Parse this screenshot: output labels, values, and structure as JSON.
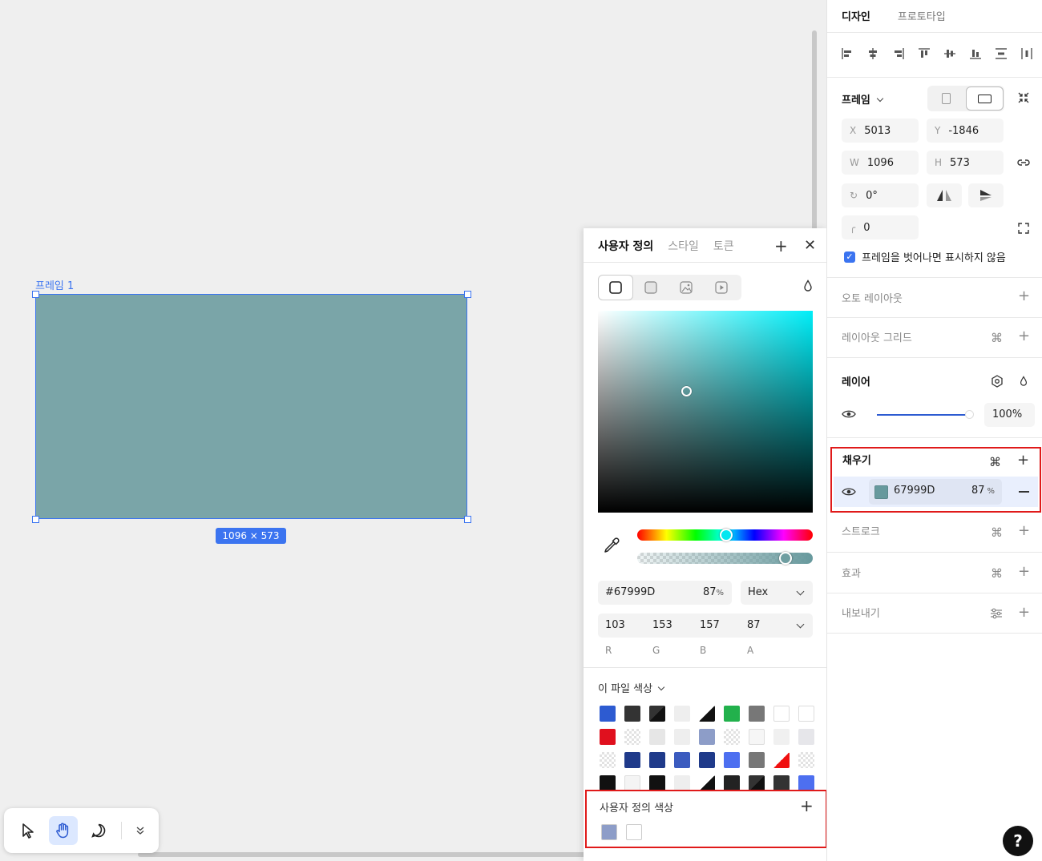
{
  "canvas": {
    "frame_label": "프레임 1",
    "frame_color": "#7aa5a8",
    "size_badge": "1096 × 573"
  },
  "toolbar": {
    "tools": [
      "pointer-icon",
      "hand-icon",
      "comment-icon",
      "chevron-double-down-icon"
    ],
    "active_tool": "hand-icon"
  },
  "color_picker": {
    "tabs": [
      "사용자 정의",
      "스타일",
      "토큰"
    ],
    "active_tab": "사용자 정의",
    "hex_value": "#67999D",
    "opacity": "87",
    "opacity_unit": "%",
    "format": "Hex",
    "rgba_values": [
      "103",
      "153",
      "157",
      "87"
    ],
    "rgba_labels": [
      "R",
      "G",
      "B",
      "A"
    ],
    "file_colors_title": "이 파일 색상",
    "file_colors": [
      "#2d5bd1",
      "#333333",
      "diag-black",
      "#eeeeee",
      "diag-black-white",
      "#22b14c",
      "#777777",
      "#ffffff",
      "#ffffff",
      "#e0101e",
      "checker",
      "#e6e6e6",
      "#eeeeee",
      "#8d9dc8",
      "checker",
      "#f6f6f6",
      "#f0f0f0",
      "#e6e6ea",
      "checker",
      "#1f3a8a",
      "#1f3a8a",
      "#3b5bbf",
      "#1f3a8a",
      "#4d6ff0",
      "#777777",
      "diag-red",
      "checker",
      "#111111",
      "#f4f4f4",
      "#111111",
      "#eeeeee",
      "diag-black-white",
      "#222222",
      "diag-black",
      "#333333",
      "#4d6ff0"
    ],
    "custom_colors_title": "사용자 정의 색상",
    "custom_colors": [
      "#8d9dc8",
      "#ffffff"
    ]
  },
  "panel": {
    "tabs": [
      "디자인",
      "프로토타입"
    ],
    "active_tab": "디자인",
    "frame_title": "프레임",
    "x_label": "X",
    "x_value": "5013",
    "y_label": "Y",
    "y_value": "-1846",
    "w_label": "W",
    "w_value": "1096",
    "h_label": "H",
    "h_value": "573",
    "rotation": "0°",
    "radius": "0",
    "clip_content_label": "프레임을 벗어나면 표시하지 않음",
    "sections": {
      "auto_layout": "오토 레이아웃",
      "layout_grid": "레이아웃 그리드",
      "layer": "레이어",
      "layer_opacity": "100%",
      "fill": "채우기",
      "fill_hex": "67999D",
      "fill_opacity": "87",
      "fill_opacity_unit": "%",
      "stroke": "스트로크",
      "effect": "효과",
      "export": "내보내기"
    }
  },
  "help_label": "?"
}
